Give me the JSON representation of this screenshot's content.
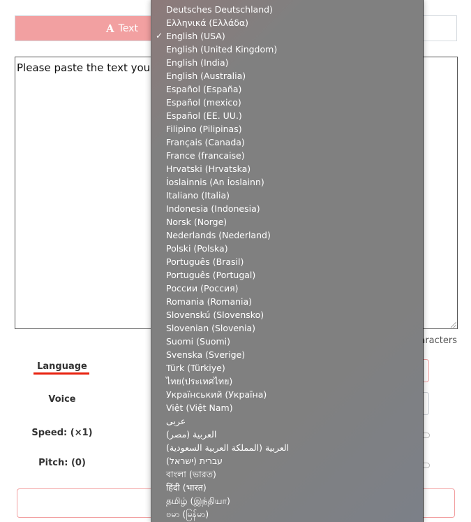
{
  "tabs": {
    "text_label": "Text",
    "text_icon": "A"
  },
  "textarea": {
    "visible_placeholder": "Please paste the text you w"
  },
  "char_count": "aracters",
  "labels": {
    "language": "Language",
    "voice": "Voice",
    "speed": "Speed: (×1)",
    "pitch": "Pitch: (0)"
  },
  "colors": {
    "accent": "#f2a0a1",
    "underline": "#e8220f"
  },
  "language_menu": {
    "selected": "English (USA)",
    "items": [
      "Deutsches Deutschland)",
      "Ελληνικά (Ελλάδα)",
      "English (USA)",
      "English (United Kingdom)",
      "English (India)",
      "English (Australia)",
      "Español (España)",
      "Español (mexico)",
      "Español (EE. UU.)",
      "Filipino (Pilipinas)",
      "Français (Canada)",
      "France (francaise)",
      "Hrvatski (Hrvatska)",
      "Íoslainnis (An Íoslainn)",
      "Italiano (Italia)",
      "Indonesia (Indonesia)",
      "Norsk (Norge)",
      "Nederlands (Nederland)",
      "Polski (Polska)",
      "Português (Brasil)",
      "Português (Portugal)",
      "России (Россия)",
      "Romania (Romania)",
      "Slovenskú (Slovensko)",
      "Slovenian (Slovenia)",
      "Suomi (Suomi)",
      "Svenska (Sverige)",
      "Türk (Türkiye)",
      "ไทย(ประเทศไทย)",
      "Український (Україна)",
      "Việt (Việt Nam)",
      "عربى",
      "العربية (مصر)",
      "العربية (المملكة العربية السعودية)",
      "עברית (ישראל)",
      "বাংলা (ভারত)",
      "हिंदी (भारत)",
      "தமிழ் (இந்தியா)",
      "ဗမာ (မြန်မာ)"
    ]
  }
}
